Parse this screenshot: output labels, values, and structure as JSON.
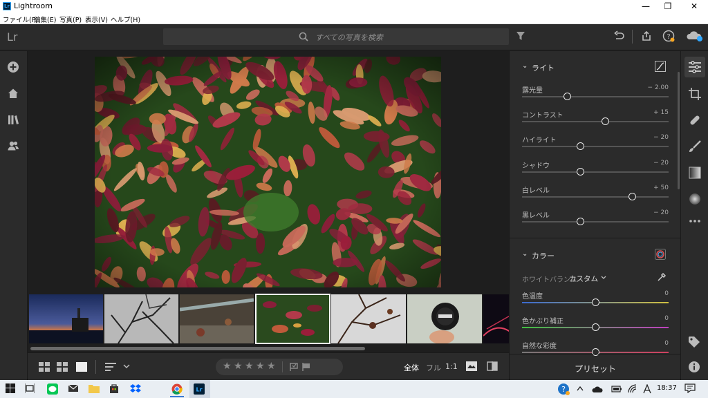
{
  "window": {
    "title": "Lightroom",
    "minimize": "—",
    "maximize": "❐",
    "close": "✕"
  },
  "menu": [
    {
      "label": "ファイル(F)"
    },
    {
      "label": "編集(E)"
    },
    {
      "label": "写真(P)"
    },
    {
      "label": "表示(V)"
    },
    {
      "label": "ヘルプ(H)"
    }
  ],
  "topbar": {
    "logo": "Lr",
    "search_placeholder": "すべての写真を検索"
  },
  "edit_panel": {
    "light": {
      "title": "ライト",
      "sliders": [
        {
          "name": "露光量",
          "value": "− 2.00",
          "position": 0.31
        },
        {
          "name": "コントラスト",
          "value": "+ 15",
          "position": 0.57
        },
        {
          "name": "ハイライト",
          "value": "− 20",
          "position": 0.4
        },
        {
          "name": "シャドウ",
          "value": "− 20",
          "position": 0.4
        },
        {
          "name": "白レベル",
          "value": "+ 50",
          "position": 0.75
        },
        {
          "name": "黒レベル",
          "value": "− 20",
          "position": 0.4
        }
      ]
    },
    "color": {
      "title": "カラー",
      "wb_label": "ホワイトバランス",
      "wb_value": "カスタム",
      "sliders": [
        {
          "name": "色温度",
          "value": "0",
          "position": 0.5
        },
        {
          "name": "色かぶり補正",
          "value": "0",
          "position": 0.5
        },
        {
          "name": "自然な彩度",
          "value": "0",
          "position": 0.5
        }
      ]
    },
    "preset_label": "プリセット"
  },
  "bottombar": {
    "fit_all": "全体",
    "fit_full": "フル",
    "fit_ratio": "1:1",
    "stars": [
      "★",
      "★",
      "★",
      "★",
      "★"
    ]
  },
  "taskbar": {
    "time": "18:37"
  },
  "colors": {
    "accent": "#31a8ff",
    "panel": "#2b2b2b",
    "background": "#1e1e1e"
  }
}
